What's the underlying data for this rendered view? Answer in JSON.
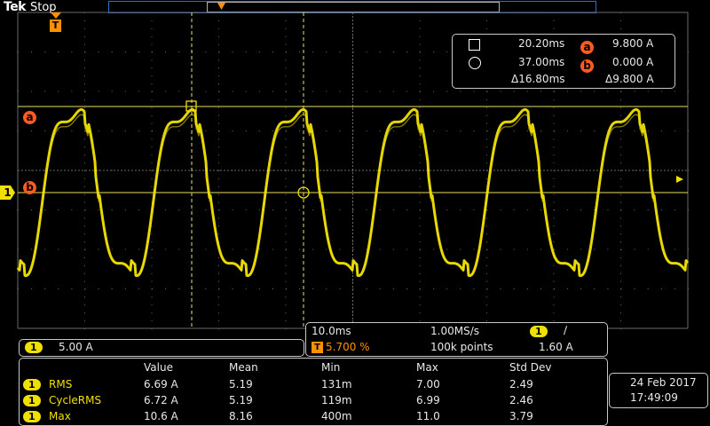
{
  "header": {
    "brand": "Tek",
    "status": "Stop"
  },
  "trigger": {
    "marker": "T"
  },
  "cursors": {
    "a": {
      "time": "20.20ms",
      "value": "9.800 A",
      "label": "a"
    },
    "b": {
      "time": "37.00ms",
      "value": "0.000 A",
      "label": "b"
    },
    "delta_time": "Δ16.80ms",
    "delta_value": "Δ9.800 A"
  },
  "channel": {
    "number": "1",
    "scale": "5.00 A"
  },
  "horizontal": {
    "timebase": "10.0ms",
    "sample_rate": "1.00MS/s",
    "trigger_position": "5.700 %",
    "record_length": "100k points",
    "trigger_channel": "1",
    "trigger_slope": "∕",
    "trigger_level": "1.60 A"
  },
  "measurements": {
    "headers": [
      "Value",
      "Mean",
      "Min",
      "Max",
      "Std Dev"
    ],
    "rows": [
      {
        "ch": "1",
        "name": "RMS",
        "value": "6.69 A",
        "mean": "5.19",
        "min": "131m",
        "max": "7.00",
        "std": "2.49"
      },
      {
        "ch": "1",
        "name": "CycleRMS",
        "value": "6.72 A",
        "mean": "5.19",
        "min": "119m",
        "max": "6.99",
        "std": "2.46"
      },
      {
        "ch": "1",
        "name": "Max",
        "value": "10.6 A",
        "mean": "8.16",
        "min": "400m",
        "max": "11.0",
        "std": "3.79"
      }
    ]
  },
  "datetime": {
    "date": "24 Feb 2017",
    "time": "17:49:09"
  },
  "colors": {
    "trace": "#f0e000",
    "cursor": "#ff5a1f",
    "graticule": "#6a6a6a"
  }
}
